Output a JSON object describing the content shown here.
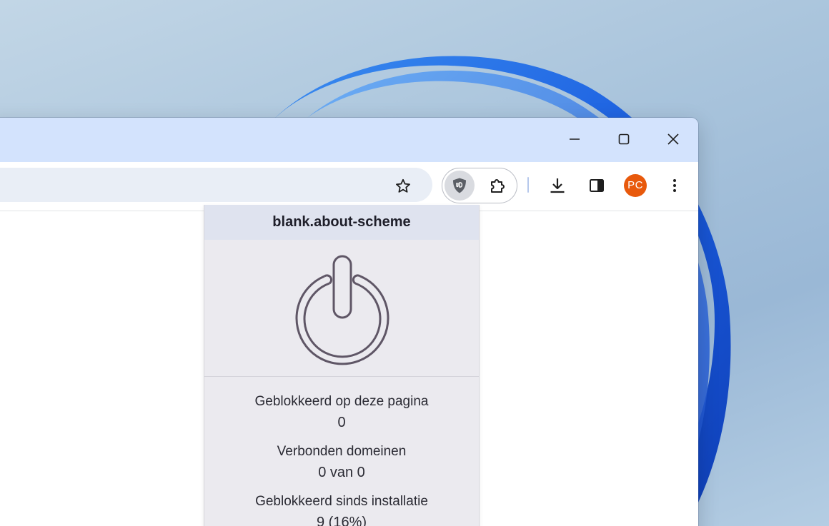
{
  "window_controls": {
    "minimize": "minimize",
    "maximize": "maximize",
    "close": "close"
  },
  "toolbar": {
    "icons": [
      "bookmark-star-icon",
      "ublock-origin-icon",
      "extensions-puzzle-icon",
      "download-icon",
      "side-panel-icon",
      "more-menu-icon"
    ],
    "profile_initials": "PC",
    "profile_color": "#e8590c"
  },
  "popup": {
    "hostname": "blank.about-scheme",
    "power_icon": "power-icon",
    "stats": [
      {
        "label": "Geblokkeerd op deze pagina",
        "value": "0"
      },
      {
        "label": "Verbonden domeinen",
        "value": "0 van 0"
      },
      {
        "label": "Geblokkeerd sinds installatie",
        "value": "9 (16%)"
      }
    ]
  },
  "colors": {
    "titlebar": "#d3e3fd",
    "popup_bg": "#ebeaef",
    "popup_header": "#dfe3ef",
    "power_stroke": "#5f5666"
  }
}
